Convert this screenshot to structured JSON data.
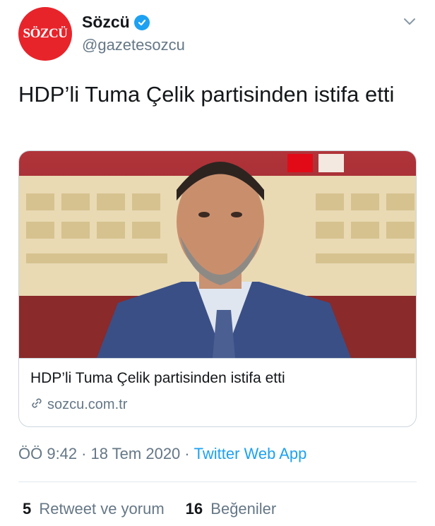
{
  "account": {
    "avatar_text": "SÖZCÜ",
    "display_name": "Sözcü",
    "handle": "@gazetesozcu",
    "verified": true
  },
  "tweet": {
    "text": "HDP’li Tuma Çelik partisinden istifa etti"
  },
  "card": {
    "title": "HDP’li Tuma Çelik partisinden istifa etti",
    "domain": "sozcu.com.tr",
    "link_icon": "link-icon"
  },
  "meta": {
    "time": "ÖÖ 9:42",
    "date": "18 Tem 2020",
    "source": "Twitter Web App"
  },
  "stats": {
    "retweets_count": "5",
    "retweets_label": "Retweet ve yorum",
    "likes_count": "16",
    "likes_label": "Beğeniler"
  },
  "colors": {
    "brand_red": "#e8242b",
    "link_blue": "#1da1f2",
    "muted_gray": "#657786"
  }
}
